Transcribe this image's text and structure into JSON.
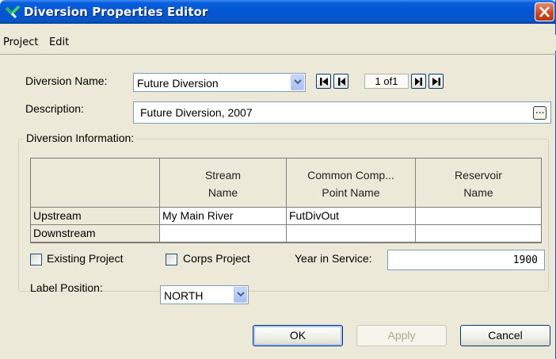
{
  "window": {
    "title": "Diversion Properties Editor",
    "colors": {
      "titlebar": "#0255d3",
      "window_bg": "#ece9d8",
      "close": "#d0451c"
    }
  },
  "menu": {
    "items": [
      "Project",
      "Edit"
    ]
  },
  "diversion_name": {
    "label": "Diversion Name:",
    "selected": "Future Diversion"
  },
  "record_nav": {
    "count_text": "1 of1"
  },
  "description": {
    "label": "Description:",
    "value": "Future Diversion, 2007",
    "browse_label": "..."
  },
  "diversion_info": {
    "group_label": "Diversion Information:",
    "columns": [
      {
        "line1": "",
        "line2": ""
      },
      {
        "line1": "Stream",
        "line2": "Name"
      },
      {
        "line1": "Common Comp...",
        "line2": "Point Name"
      },
      {
        "line1": "Reservoir",
        "line2": "Name"
      }
    ],
    "rows": [
      {
        "label": "Upstream",
        "stream": "My Main River",
        "point": "FutDivOut",
        "reservoir": ""
      },
      {
        "label": "Downstream",
        "stream": "",
        "point": "",
        "reservoir": ""
      }
    ]
  },
  "options": {
    "existing_project": {
      "label": "Existing Project",
      "checked": false
    },
    "corps_project": {
      "label": "Corps Project",
      "checked": false
    },
    "year_in_service": {
      "label": "Year in Service:",
      "value": "1900"
    },
    "label_position": {
      "label": "Label Position:",
      "selected": "NORTH"
    }
  },
  "buttons": {
    "ok": "OK",
    "apply": "Apply",
    "cancel": "Cancel"
  }
}
